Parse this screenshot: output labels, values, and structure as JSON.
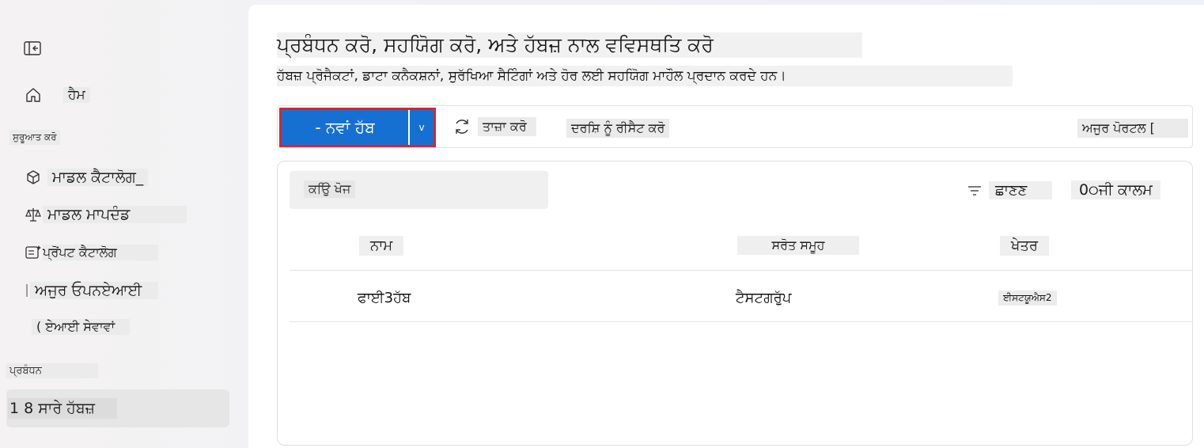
{
  "sidebar": {
    "home_label": "ਹੈਮ",
    "section_getting_started": "ਸੁਰੂਆਤ ਕਰੋ",
    "items": [
      {
        "label": "ਮਾਡਲ ਕੈਟਾਲੋਗ_",
        "icon": "cube-icon"
      },
      {
        "label": "ਮਾਡਲ ਮਾਪਦੰਡ",
        "icon": "scale-icon"
      },
      {
        "label": "ਪ੍ਰੋਂਪਟ ਕੈਟਾਲੋਗ",
        "icon": "prompt-catalog-icon"
      },
      {
        "label": "ਅਜੁਰ ਓਪਨਏਆਈ",
        "icon": "openai-icon"
      },
      {
        "label": "( ਏਆਈ ਸੇਵਾਵਾਂ",
        "icon": "ai-services-icon"
      }
    ],
    "section_management": "ਪ੍ਰਬੰਧਨ",
    "active_item": "1 8 ਸਾਰੇ ਹੱਬਜ਼"
  },
  "header": {
    "title": "ਪ੍ਰਬੰਧਨ ਕਰੋ, ਸਹਯਿੋਗ ਕਰੋ, ਅਤੇ ਹੱਬਜ਼ ਨਾਲ ਵਵਿਸਥਤਿ ਕਰੋ",
    "subtitle": "ਹੱਬਜ਼ ਪ੍ਰੋਜੈਕਟਾਂ, ਡਾਟਾ ਕਨੈਕਸ਼ਨਾਂ, ਸੁਰੱਖਿਆ ਸੈਟਿੰਗਾਂ ਅਤੇ ਹੋਰ ਲਈ ਸਹਯਿੋਗ ਮਾਹੌਲ ਪ੍ਰਦਾਨ ਕਰਦੇ ਹਨ।"
  },
  "toolbar": {
    "new_hub_label": "- ਨਵਾਂ ਹੱਬ",
    "caret": "v",
    "refresh_label": "ਤਾਜ਼ਾ ਕਰੋ",
    "reset_view_label": "ਦਰਸ਼ਿ ਨੂੰ ਰੀਸੈਟ ਕਰੋ",
    "azure_portal_label": "ਅਜੁਰ ਪੋਰਟਲ ["
  },
  "table": {
    "search_placeholder": "ਕਉਿ ਖੋਜ",
    "filter_label": "ਛਾਣਣ",
    "column_options_label": "0੦ਜੀ ਕਾਲਮ",
    "columns": [
      "ਨਾਮ",
      "ਸਰੋਤ ਸਮੂਹ",
      "ਖੇਤਰ"
    ],
    "rows": [
      {
        "name": "ਫਾਈ3ਹੱਬ",
        "resource_group": "ਟੈਸਟਗਰੁੱਪ",
        "region": "ਈਸਟਯੂਐਸ2"
      }
    ]
  }
}
